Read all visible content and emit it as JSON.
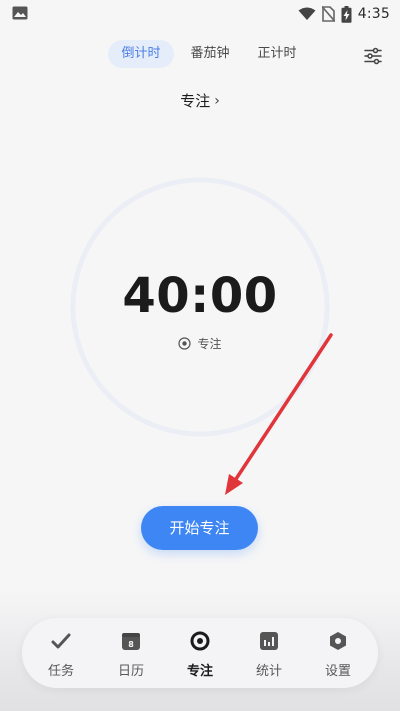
{
  "status_bar": {
    "time": "4:35",
    "icons": [
      "image-icon",
      "wifi-icon",
      "no-sim-icon",
      "battery-charging-icon"
    ]
  },
  "mode_tabs": [
    {
      "label": "倒计时",
      "active": true
    },
    {
      "label": "番茄钟",
      "active": false
    },
    {
      "label": "正计时",
      "active": false
    }
  ],
  "toolbar": {
    "settings_icon": "sliders-icon"
  },
  "focus": {
    "title": "专注",
    "title_chevron": "›",
    "timer": "40:00",
    "subtitle": "专注",
    "subtitle_icon": "target-icon"
  },
  "actions": {
    "start_label": "开始专注"
  },
  "bottom_nav": [
    {
      "label": "任务",
      "icon": "check-icon",
      "active": false
    },
    {
      "label": "日历",
      "icon": "calendar-icon",
      "calendar_day": "8",
      "active": false
    },
    {
      "label": "专注",
      "icon": "focus-target-icon",
      "active": true
    },
    {
      "label": "统计",
      "icon": "bar-chart-icon",
      "active": false
    },
    {
      "label": "设置",
      "icon": "hexagon-settings-icon",
      "active": false
    }
  ],
  "colors": {
    "accent": "#3d86f4",
    "tab_active_bg": "#e5ecfa",
    "tab_active_text": "#4b7fe6",
    "ring": "#eceef6",
    "annotation_arrow": "#e0353a",
    "background": "#f6f6f7"
  }
}
